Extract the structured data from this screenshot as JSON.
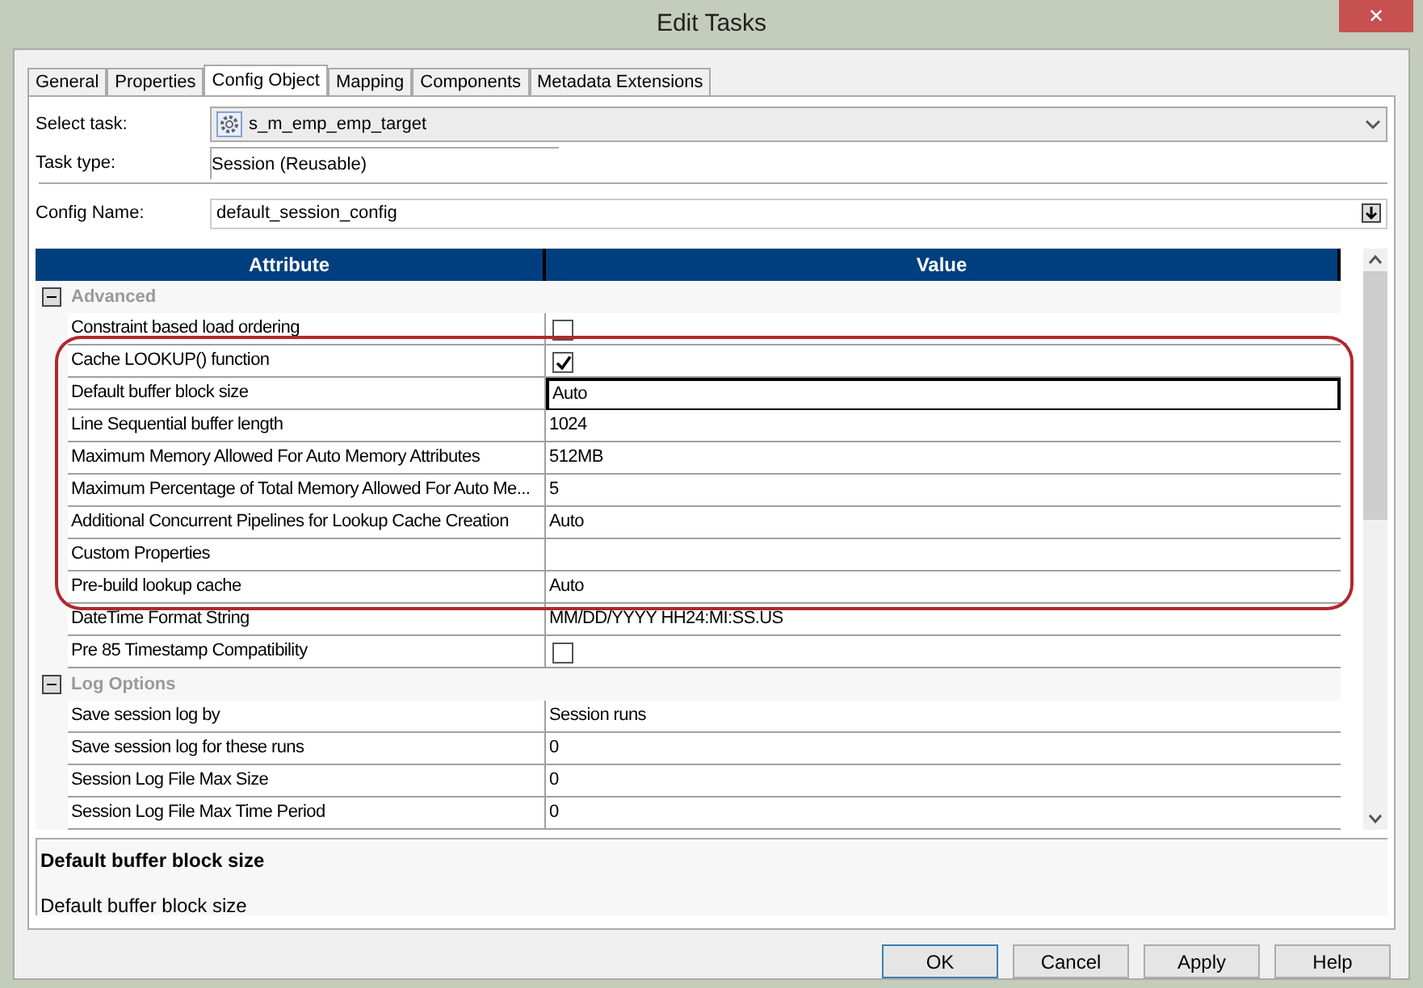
{
  "window": {
    "title": "Edit Tasks",
    "close": "✕"
  },
  "tabs": [
    {
      "label": "General",
      "selected": false
    },
    {
      "label": "Properties",
      "selected": false
    },
    {
      "label": "Config Object",
      "selected": true
    },
    {
      "label": "Mapping",
      "selected": false
    },
    {
      "label": "Components",
      "selected": false
    },
    {
      "label": "Metadata Extensions",
      "selected": false
    }
  ],
  "select_task": {
    "label": "Select task:",
    "value": "s_m_emp_emp_target"
  },
  "task_type": {
    "label": "Task type:",
    "value": "Session (Reusable)"
  },
  "config_name": {
    "label": "Config Name:",
    "value": "default_session_config"
  },
  "grid": {
    "columns": [
      "Attribute",
      "Value"
    ],
    "sections": [
      {
        "name": "Advanced",
        "expanded": true,
        "rows": [
          {
            "attribute": "Constraint based load ordering",
            "kind": "checkbox",
            "checked": false,
            "highlighted": false,
            "selected": false
          },
          {
            "attribute": "Cache LOOKUP() function",
            "kind": "checkbox",
            "checked": true,
            "highlighted": true,
            "selected": false
          },
          {
            "attribute": "Default buffer block size",
            "kind": "text",
            "value": "Auto",
            "highlighted": true,
            "selected": true
          },
          {
            "attribute": "Line Sequential buffer length",
            "kind": "text",
            "value": "1024",
            "highlighted": true,
            "selected": false
          },
          {
            "attribute": "Maximum Memory Allowed For Auto Memory Attributes",
            "kind": "text",
            "value": "512MB",
            "highlighted": true,
            "selected": false
          },
          {
            "attribute": "Maximum Percentage of Total Memory Allowed For Auto Me...",
            "kind": "text",
            "value": "5",
            "highlighted": true,
            "selected": false
          },
          {
            "attribute": "Additional Concurrent Pipelines for Lookup Cache Creation",
            "kind": "text",
            "value": "Auto",
            "highlighted": true,
            "selected": false
          },
          {
            "attribute": "Custom Properties",
            "kind": "text",
            "highlighted": true,
            "selected": false
          },
          {
            "attribute": "Pre-build lookup cache",
            "kind": "text",
            "value": "Auto",
            "highlighted": true,
            "selected": false
          },
          {
            "attribute": "DateTime Format String",
            "kind": "text",
            "value": "MM/DD/YYYY HH24:MI:SS.US",
            "highlighted": false,
            "selected": false
          },
          {
            "attribute": "Pre 85 Timestamp Compatibility",
            "kind": "checkbox",
            "checked": false,
            "highlighted": false,
            "selected": false
          }
        ]
      },
      {
        "name": "Log Options",
        "expanded": true,
        "rows": [
          {
            "attribute": "Save session log by",
            "kind": "text",
            "value": "Session runs",
            "highlighted": false,
            "selected": false
          },
          {
            "attribute": "Save session log for these runs",
            "kind": "text",
            "value": "0",
            "highlighted": false,
            "selected": false
          },
          {
            "attribute": "Session Log File Max Size",
            "kind": "text",
            "value": "0",
            "highlighted": false,
            "selected": false
          },
          {
            "attribute": "Session Log File Max Time Period",
            "kind": "text",
            "value": "0",
            "highlighted": false,
            "selected": false
          }
        ]
      }
    ]
  },
  "description": {
    "title": "Default buffer block size",
    "text": "Default buffer block size"
  },
  "buttons": [
    {
      "label": "OK",
      "focused": true
    },
    {
      "label": "Cancel",
      "focused": false
    },
    {
      "label": "Apply",
      "focused": false
    },
    {
      "label": "Help",
      "focused": false
    }
  ]
}
